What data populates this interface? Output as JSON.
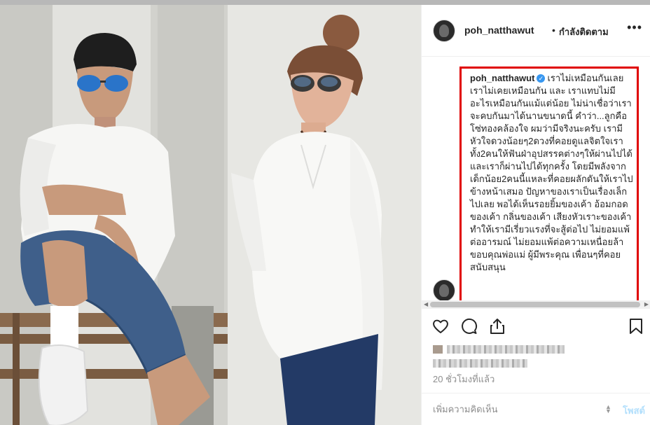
{
  "post": {
    "header": {
      "username": "poh_natthawut",
      "separator": "•",
      "follow_status": "กำลังติดตาม",
      "more_icon": "more-icon"
    },
    "caption": {
      "username": "poh_natthawut",
      "verified_icon": "verified-icon",
      "text": "เราไม่เหมือนกันเลย เราไม่เคยเหมือนกัน และ เราแทบไม่มีอะไรเหมือนกันแม้แต่น้อย ไม่น่าเชื่อว่าเราจะคบกันมาได้นานขนาดนี้ คำว่า...ลูกคือโซ่ทองคล้องใจ ผมว่ามีจริงนะครับ เรามีหัวใจดวงน้อยๆ2ดวงที่คอยดูแลจิตใจเราทั้ง2คนให้ฟันฝ่าอุปสรรคต่างๆให้ผ่านไปได้ และเราก็ผ่านไปได้ทุกครั้ง โดยมีพลังจากเด็กน้อย2คนนี้แหละที่คอยผลักดันให้เราไปข้างหน้าเสมอ ปัญหาของเราเป็นเรื่องเล็กไปเลย พอได้เห็นรอยยิ้มของเค้า อ้อมกอดของเค้า กลิ่นของเค้า เสียงหัวเราะของเค้าทำให้เรามีเรี่ยวแรงที่จะสู้ต่อไป ไม่ยอมแพ้ต่ออารมณ์ ไม่ยอมแพ้ต่อความเหนื่อยล้า ขอบคุณพ่อแม่ ผู้มีพระคุณ เพื่อนๆที่คอยสนับสนุน"
    },
    "actions": {
      "like_icon": "heart-icon",
      "comment_icon": "comment-icon",
      "share_icon": "share-icon",
      "save_icon": "bookmark-icon"
    },
    "timestamp": "20 ชั่วโมงที่แล้ว",
    "comment_box": {
      "placeholder": "เพิ่มความคิดเห็น",
      "post_label": "โพสต์"
    }
  },
  "colors": {
    "highlight_border": "#e00000",
    "verified": "#3897f0",
    "post_button_disabled": "#b2dffc",
    "text_primary": "#262626",
    "text_secondary": "#8e8e8e"
  }
}
